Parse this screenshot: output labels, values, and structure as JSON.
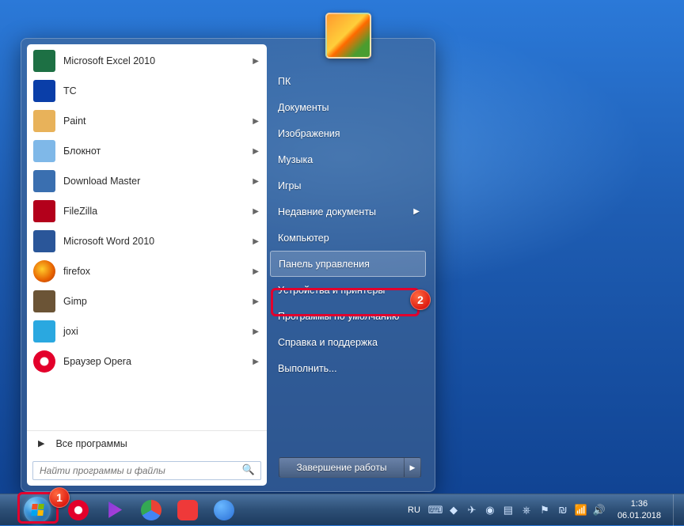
{
  "programs": [
    {
      "name": "Microsoft Excel 2010",
      "arrow": true,
      "icon": "excel"
    },
    {
      "name": "TC",
      "arrow": false,
      "icon": "tc"
    },
    {
      "name": "Paint",
      "arrow": true,
      "icon": "paint"
    },
    {
      "name": "Блокнот",
      "arrow": true,
      "icon": "notepad"
    },
    {
      "name": "Download Master",
      "arrow": true,
      "icon": "dm"
    },
    {
      "name": "FileZilla",
      "arrow": true,
      "icon": "filezilla"
    },
    {
      "name": "Microsoft Word 2010",
      "arrow": true,
      "icon": "word"
    },
    {
      "name": "firefox",
      "arrow": true,
      "icon": "firefox"
    },
    {
      "name": "Gimp",
      "arrow": true,
      "icon": "gimp"
    },
    {
      "name": "joxi",
      "arrow": true,
      "icon": "joxi"
    },
    {
      "name": "Браузер Opera",
      "arrow": true,
      "icon": "opera"
    }
  ],
  "all_programs": "Все программы",
  "search_placeholder": "Найти программы и файлы",
  "right": [
    {
      "label": "ПК"
    },
    {
      "label": "Документы"
    },
    {
      "label": "Изображения"
    },
    {
      "label": "Музыка"
    },
    {
      "label": "Игры"
    },
    {
      "label": "Недавние документы",
      "arrow": true
    },
    {
      "label": "Компьютер"
    },
    {
      "label": "Панель управления",
      "hl": true
    },
    {
      "label": "Устройства и принтеры"
    },
    {
      "label": "Программы по умолчанию"
    },
    {
      "label": "Справка и поддержка"
    },
    {
      "label": "Выполнить..."
    }
  ],
  "shutdown": "Завершение работы",
  "tray": {
    "lang": "RU",
    "time": "1:36",
    "date": "06.01.2018"
  },
  "badges": {
    "one": "1",
    "two": "2"
  },
  "icon_colors": {
    "excel": "#1d7044",
    "tc": "#0a3ea8",
    "paint": "#e8b25a",
    "notepad": "#7fb8e8",
    "dm": "#3a6fb0",
    "filezilla": "#b3001b",
    "word": "#2a5699",
    "firefox": "#e66000",
    "gimp": "#6b5436",
    "joxi": "#2aa8e0",
    "opera": "#e3002b"
  },
  "tb": [
    {
      "name": "opera",
      "bg": "#e3002b"
    },
    {
      "name": "media",
      "bg": "#7a3ddb"
    },
    {
      "name": "chrome",
      "bg": "#ffffff"
    },
    {
      "name": "vivaldi",
      "bg": "#ef3939"
    },
    {
      "name": "maxthon",
      "bg": "#2a6fd6"
    }
  ]
}
